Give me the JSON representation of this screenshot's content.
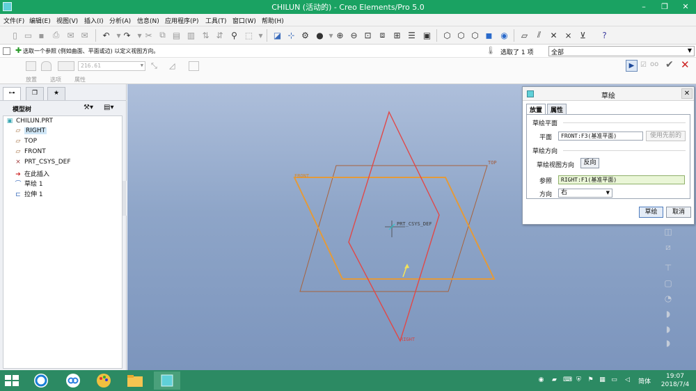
{
  "window": {
    "title": "CHILUN (活动的) - Creo Elements/Pro 5.0",
    "minimize": "–",
    "maximize": "❐",
    "close": "✕"
  },
  "menu": [
    "文件(F)",
    "编辑(E)",
    "视图(V)",
    "插入(I)",
    "分析(A)",
    "信息(N)",
    "应用程序(P)",
    "工具(T)",
    "窗口(W)",
    "帮助(H)"
  ],
  "message": {
    "text": "选取一个参照 (例如曲面、平面或边) 以定义视图方向。"
  },
  "selection": {
    "count_text": "选取了 1 项",
    "filter": "全部"
  },
  "dashboard": {
    "depth_value": "216.61",
    "tabs": [
      "放置",
      "选项",
      "属性"
    ]
  },
  "left_panel": {
    "tree_title": "模型树",
    "items": [
      {
        "label": "CHILUN.PRT",
        "icon": "part-icon"
      },
      {
        "label": "RIGHT",
        "icon": "datum-plane-icon"
      },
      {
        "label": "TOP",
        "icon": "datum-plane-icon"
      },
      {
        "label": "FRONT",
        "icon": "datum-plane-icon"
      },
      {
        "label": "PRT_CSYS_DEF",
        "icon": "csys-icon"
      },
      {
        "label": "在此插入",
        "icon": "insert-here-arrow-icon"
      },
      {
        "label": "草绘 1",
        "icon": "sketch-icon"
      },
      {
        "label": "拉伸 1",
        "icon": "extrude-icon"
      }
    ]
  },
  "viewport": {
    "labels": {
      "top": "TOP",
      "front": "FRONT",
      "right": "RIGHT",
      "csys": "PRT_CSYS_DEF"
    }
  },
  "sketch_dialog": {
    "title": "草绘",
    "tabs": [
      "放置",
      "属性"
    ],
    "sketch_plane_group": "草绘平面",
    "plane_label": "平面",
    "plane_value": "FRONT:F3(基准平面)",
    "use_previous": "使用先前的",
    "orientation_group": "草绘方向",
    "view_direction_label": "草绘视图方向",
    "flip_button": "反向",
    "reference_label": "参照",
    "reference_value": "RIGHT:F1(基准平面)",
    "direction_label": "方向",
    "direction_value": "右",
    "ok_button": "草绘",
    "cancel_button": "取消"
  },
  "taskbar": {
    "ime": "简体",
    "time": "19:07",
    "date": "2018/7/4"
  },
  "colors": {
    "titlebar": "#1aa262",
    "taskbar": "#2c8a63",
    "front_plane": "#e39a3a",
    "right_plane": "#e04848",
    "top_plane": "#a8623c"
  }
}
